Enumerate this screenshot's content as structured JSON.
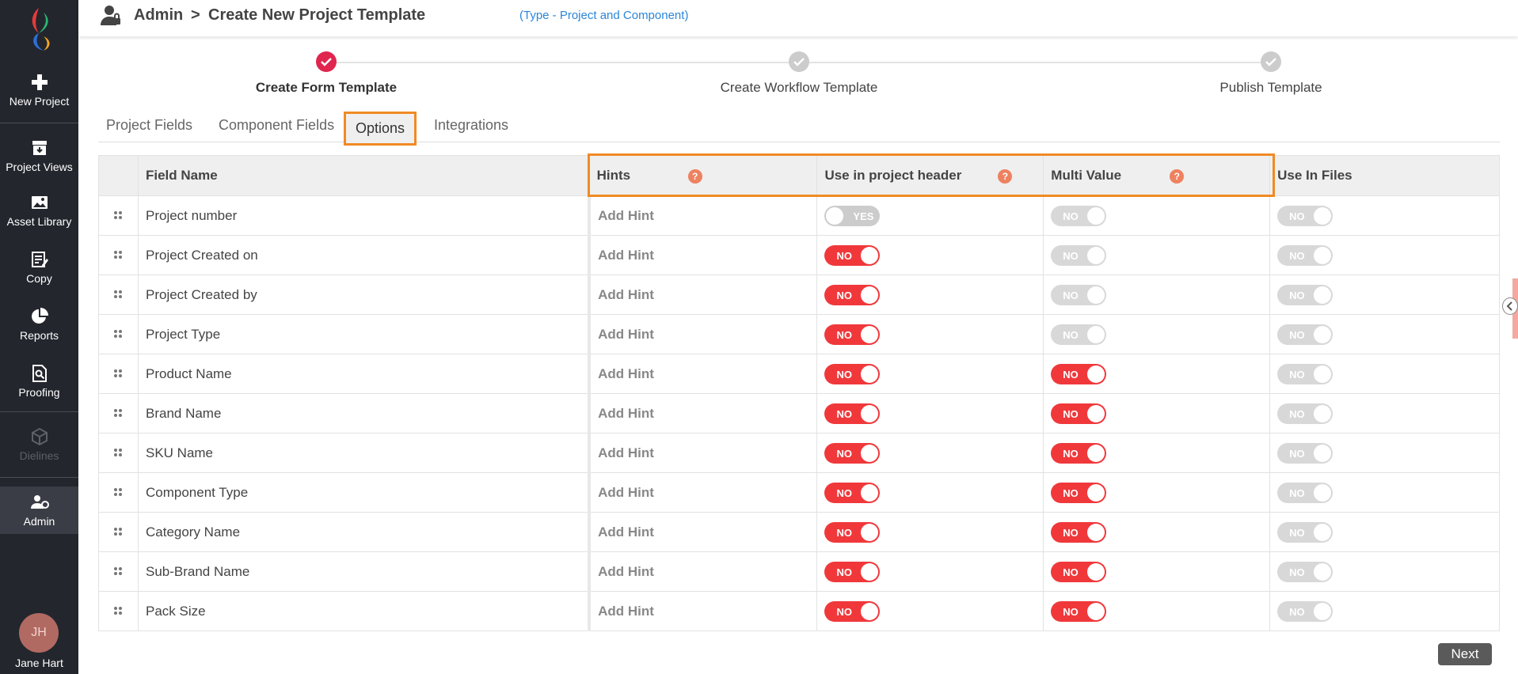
{
  "sidebar": {
    "items": [
      {
        "label": "New Project"
      },
      {
        "label": "Project Views"
      },
      {
        "label": "Asset Library"
      },
      {
        "label": "Copy"
      },
      {
        "label": "Reports"
      },
      {
        "label": "Proofing"
      },
      {
        "label": "Dielines"
      },
      {
        "label": "Admin"
      }
    ],
    "user": {
      "initials": "JH",
      "name": "Jane Hart"
    }
  },
  "header": {
    "crumb1": "Admin",
    "separator": ">",
    "crumb2": "Create New Project Template",
    "subtitle": "(Type - Project and Component)"
  },
  "steps": [
    {
      "label": "Create Form Template",
      "state": "current-complete"
    },
    {
      "label": "Create Workflow Template",
      "state": "complete"
    },
    {
      "label": "Publish Template",
      "state": "complete"
    }
  ],
  "tabs": [
    "Project Fields",
    "Component Fields",
    "Options",
    "Integrations"
  ],
  "active_tab": "Options",
  "table": {
    "columns": [
      "Field Name",
      "Hints",
      "Use in project header",
      "Multi Value",
      "Use In Files"
    ],
    "help_icon": "?",
    "rows": [
      {
        "name": "Project number",
        "hint": "Add Hint",
        "header": "YES",
        "multi": "NO",
        "files": "NO"
      },
      {
        "name": "Project Created on",
        "hint": "Add Hint",
        "header": "NO",
        "multi": "NO",
        "files": "NO"
      },
      {
        "name": "Project Created by",
        "hint": "Add Hint",
        "header": "NO",
        "multi": "NO",
        "files": "NO"
      },
      {
        "name": "Project Type",
        "hint": "Add Hint",
        "header": "NO",
        "multi": "NO",
        "files": "NO"
      },
      {
        "name": "Product Name",
        "hint": "Add Hint",
        "header": "NO",
        "multi": "NO",
        "files": "NO"
      },
      {
        "name": "Brand Name",
        "hint": "Add Hint",
        "header": "NO",
        "multi": "NO",
        "files": "NO"
      },
      {
        "name": "SKU Name",
        "hint": "Add Hint",
        "header": "NO",
        "multi": "NO",
        "files": "NO"
      },
      {
        "name": "Component Type",
        "hint": "Add Hint",
        "header": "NO",
        "multi": "NO",
        "files": "NO"
      },
      {
        "name": "Category Name",
        "hint": "Add Hint",
        "header": "NO",
        "multi": "NO",
        "files": "NO"
      },
      {
        "name": "Sub-Brand Name",
        "hint": "Add Hint",
        "header": "NO",
        "multi": "NO",
        "files": "NO"
      },
      {
        "name": "Pack Size",
        "hint": "Add Hint",
        "header": "NO",
        "multi": "NO",
        "files": "NO"
      }
    ]
  },
  "next_label": "Next",
  "colors": {
    "accent": "#f08a24",
    "toggle_on": "#f0383b",
    "toggle_disabled": "#d8d8d8",
    "step_active": "#e0254f",
    "step_done": "#cccccc",
    "link": "#2b86d9"
  }
}
